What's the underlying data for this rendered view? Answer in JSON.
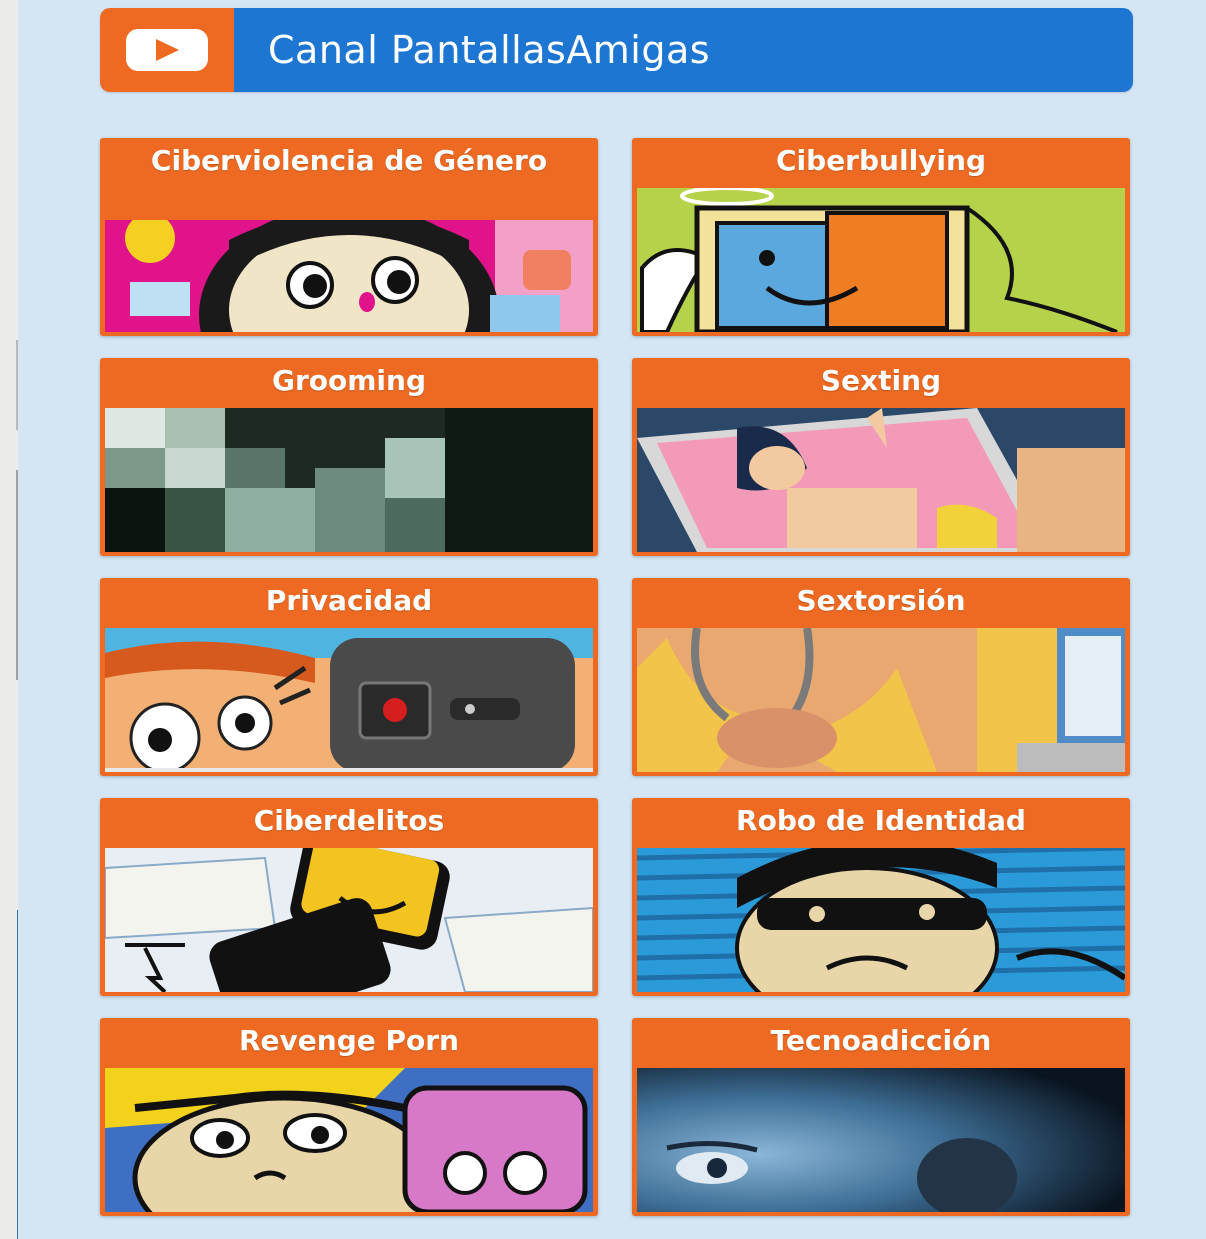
{
  "header": {
    "title": "Canal PantallasAmigas",
    "icon": "youtube-play-icon",
    "colors": {
      "icon_bg": "#ee6a22",
      "title_bg": "#1d77d2"
    }
  },
  "cards": [
    {
      "title": "Ciberviolencia de Género",
      "image": "cartoon-girl-with-phones"
    },
    {
      "title": "Ciberbullying",
      "image": "angel-devil-computer"
    },
    {
      "title": "Grooming",
      "image": "pixelated-face"
    },
    {
      "title": "Sexting",
      "image": "girl-on-phone-screen"
    },
    {
      "title": "Privacidad",
      "image": "eyes-and-camera"
    },
    {
      "title": "Sextorsión",
      "image": "hands-in-handcuffs"
    },
    {
      "title": "Ciberdelitos",
      "image": "angry-phones"
    },
    {
      "title": "Robo de Identidad",
      "image": "masked-thief"
    },
    {
      "title": "Revenge Porn",
      "image": "angry-man-with-phone"
    },
    {
      "title": "Tecnoadicción",
      "image": "child-face-screen-glow"
    }
  ],
  "colors": {
    "accent": "#ee6a22",
    "page_bg": "#d4e6f4"
  }
}
